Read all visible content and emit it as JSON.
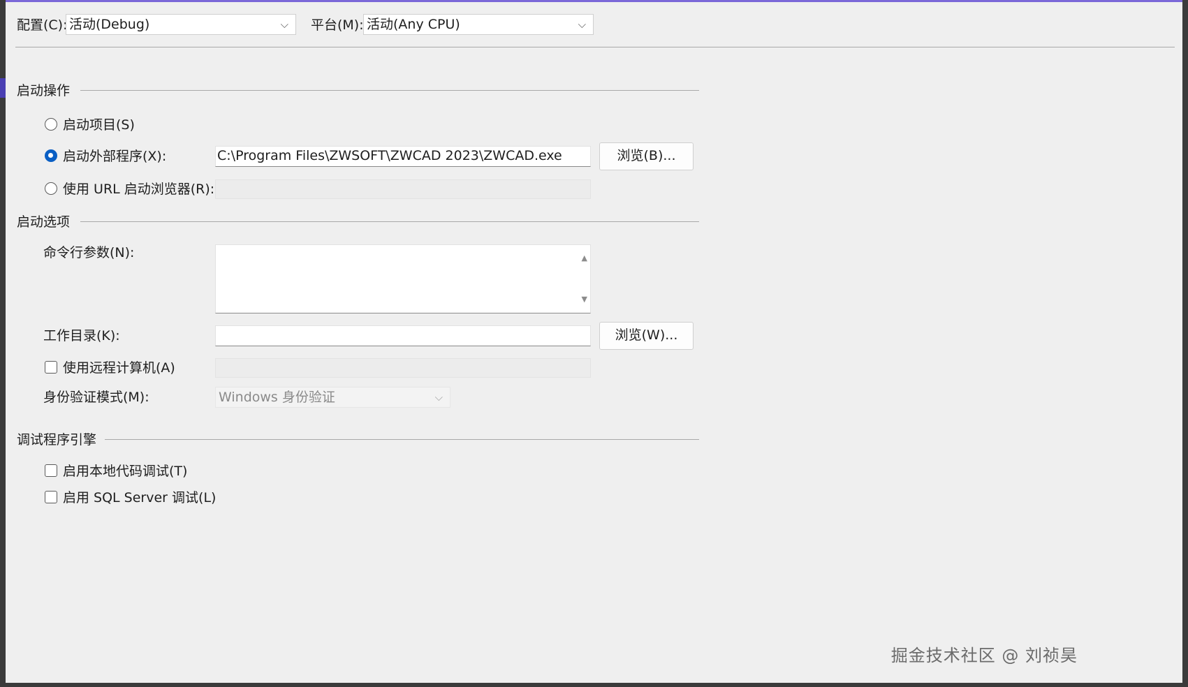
{
  "header": {
    "config_label": "配置(C):",
    "config_value": "活动(Debug)",
    "platform_label": "平台(M):",
    "platform_value": "活动(Any CPU)"
  },
  "start_action": {
    "heading": "启动操作",
    "start_project": "启动项目(S)",
    "start_external": "启动外部程序(X):",
    "external_path": "C:\\Program Files\\ZWSOFT\\ZWCAD 2023\\ZWCAD.exe",
    "browse_b": "浏览(B)...",
    "start_url": "使用 URL 启动浏览器(R):",
    "url_value": "",
    "selected": "start_external"
  },
  "start_options": {
    "heading": "启动选项",
    "cmd_args_label": "命令行参数(N):",
    "cmd_args_value": "",
    "workdir_label": "工作目录(K):",
    "workdir_value": "",
    "browse_w": "浏览(W)...",
    "remote_label": "使用远程计算机(A)",
    "remote_value": "",
    "auth_label": "身份验证模式(M):",
    "auth_value": "Windows 身份验证"
  },
  "debug_engines": {
    "heading": "调试程序引擎",
    "native_debug": "启用本地代码调试(T)",
    "sql_debug": "启用 SQL Server 调试(L)"
  },
  "watermark": "掘金技术社区 @ 刘祯昊",
  "colors": {
    "accent": "#0a5fc4",
    "top_border": "#7b68d8",
    "panel_bg": "#efefef"
  }
}
